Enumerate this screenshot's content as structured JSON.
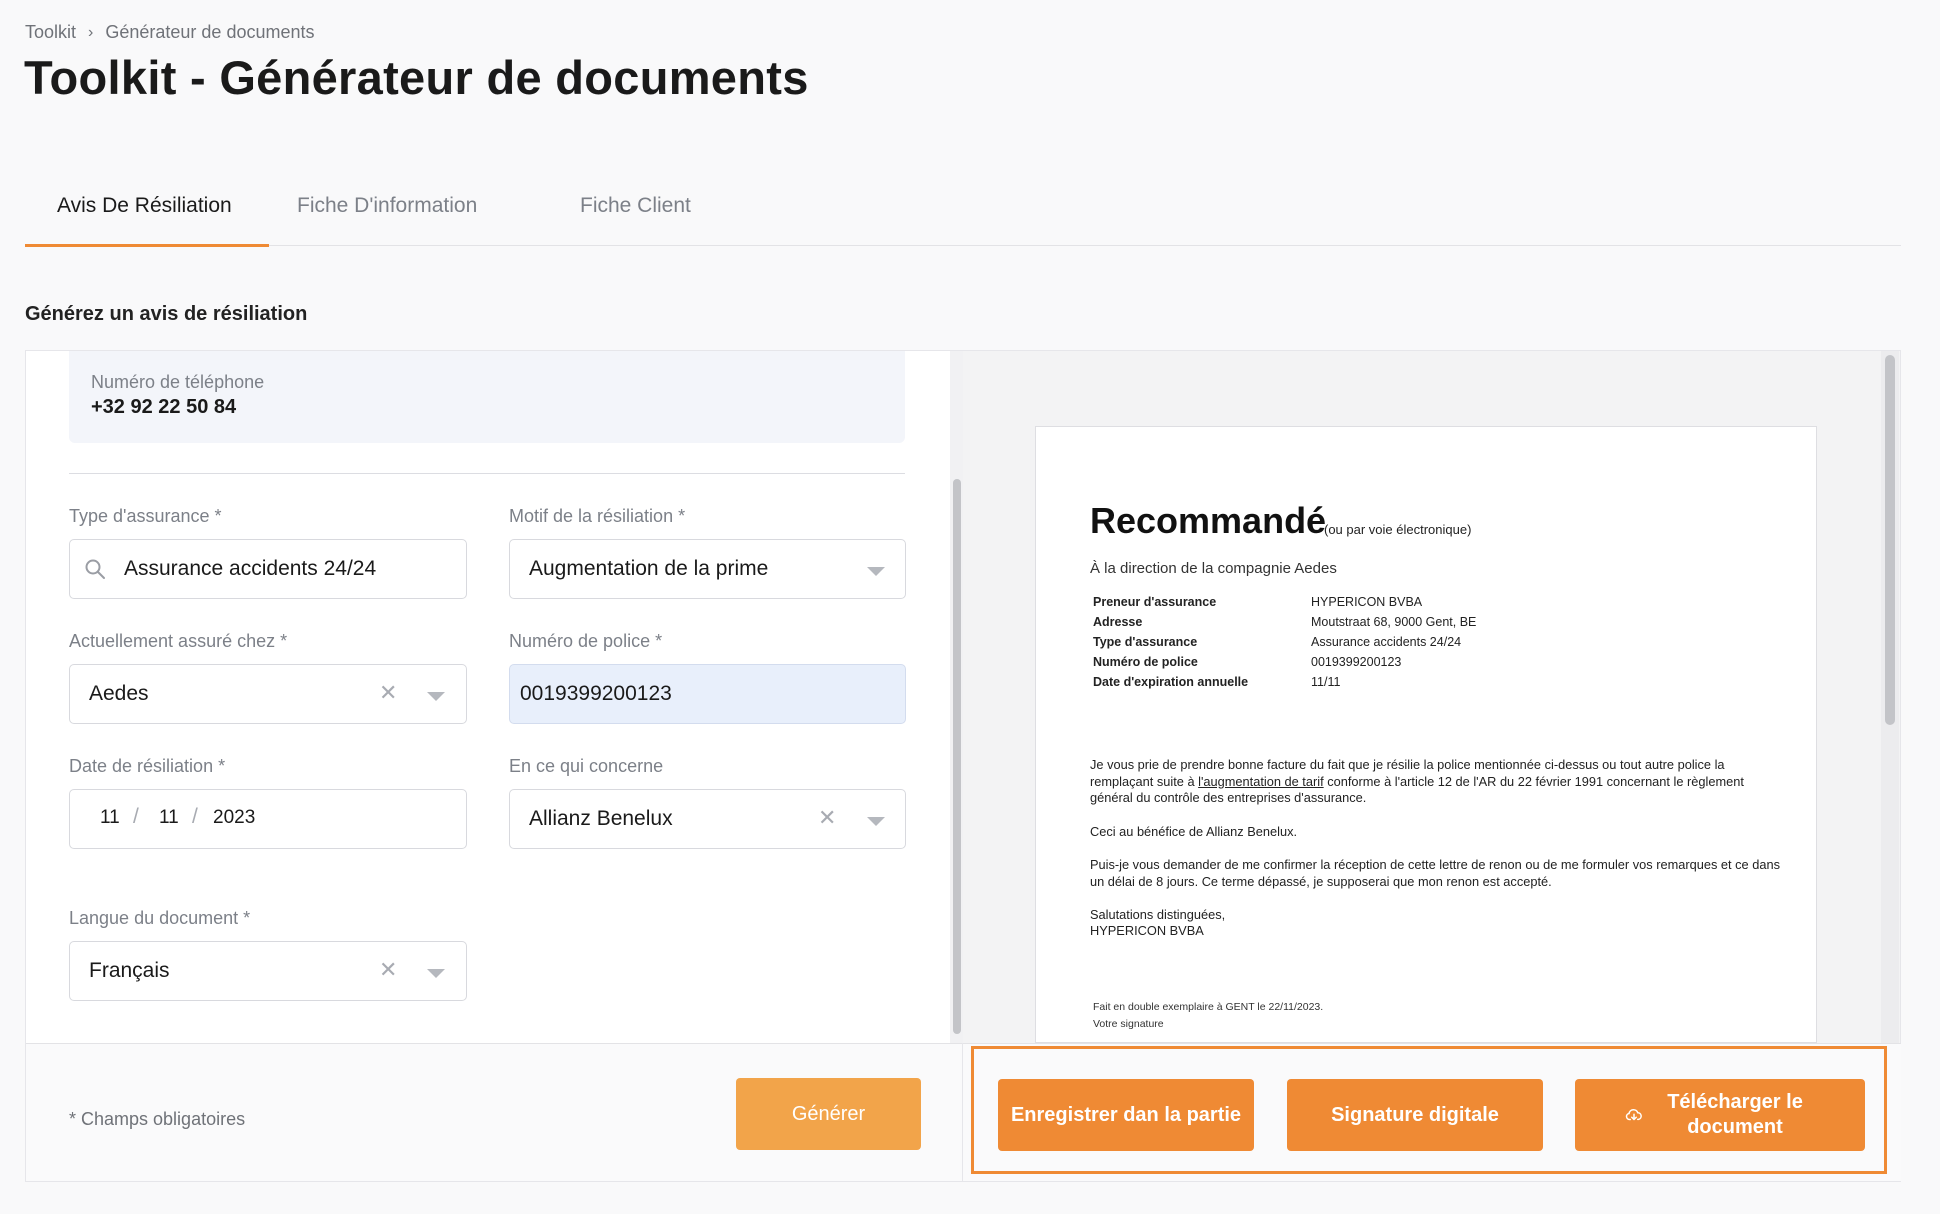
{
  "breadcrumb": {
    "root": "Toolkit",
    "separator": "›",
    "current": "Générateur de documents"
  },
  "page_title": "Toolkit - Générateur de documents",
  "tabs": [
    {
      "label": "Avis De Résiliation",
      "active": true
    },
    {
      "label": "Fiche D'information",
      "active": false
    },
    {
      "label": "Fiche Client",
      "active": false
    }
  ],
  "section_title": "Générez un avis de résiliation",
  "form": {
    "phone": {
      "label": "Numéro de téléphone",
      "value": "+32 92 22 50 84"
    },
    "insurance_type": {
      "label": "Type d'assurance *",
      "value": "Assurance accidents 24/24",
      "icon": "search-icon"
    },
    "reason": {
      "label": "Motif de la résiliation *",
      "value": "Augmentation de la prime"
    },
    "current_insurer": {
      "label": "Actuellement assuré chez *",
      "value": "Aedes"
    },
    "policy_number": {
      "label": "Numéro de police *",
      "value": "0019399200123"
    },
    "termination_date": {
      "label": "Date de résiliation *",
      "day": "11",
      "month": "11",
      "year": "2023",
      "separator": "/"
    },
    "concerning": {
      "label": "En ce qui concerne",
      "value": "Allianz Benelux"
    },
    "language": {
      "label": "Langue du document *",
      "value": "Français"
    },
    "clear_glyph": "✕",
    "required_note": "* Champs obligatoires",
    "generate_label": "Générer"
  },
  "actions": {
    "save_label": "Enregistrer dan la partie",
    "sign_label": "Signature digitale",
    "download_label": "Télécharger le document",
    "download_icon": "cloud-download-icon",
    "accent_color": "#ef8a34"
  },
  "document": {
    "title": "Recommandé",
    "subtitle": "(ou par voie électronique)",
    "recipient": "À la direction de la compagnie Aedes",
    "rows": [
      {
        "key": "Preneur d'assurance",
        "value": "HYPERICON BVBA"
      },
      {
        "key": "Adresse",
        "value": "Moutstraat 68, 9000 Gent, BE"
      },
      {
        "key": "Type d'assurance",
        "value": "Assurance accidents 24/24"
      },
      {
        "key": "Numéro de police",
        "value": "0019399200123"
      },
      {
        "key": "Date d'expiration annuelle",
        "value": "11/11"
      }
    ],
    "para1_a": "Je vous prie de prendre bonne facture du fait que je résilie la police mentionnée ci-dessus ou tout autre police la remplaçant suite à ",
    "para1_link": "l'augmentation de tarif",
    "para1_b": " conforme à l'article 12 de l'AR du 22 février 1991 concernant le règlement général du contrôle des entreprises d'assurance.",
    "para2": "Ceci au bénéfice de Allianz Benelux.",
    "para3": "Puis-je vous demander de me confirmer la réception de cette lettre de renon ou de me formuler vos remarques et ce dans un délai de 8 jours. Ce terme dépassé, je supposerai que mon renon est accepté.",
    "closing": "Salutations distinguées,",
    "signer": "HYPERICON BVBA",
    "footer_line1": "Fait en double exemplaire à GENT le 22/11/2023.",
    "footer_line2": "Votre signature"
  }
}
